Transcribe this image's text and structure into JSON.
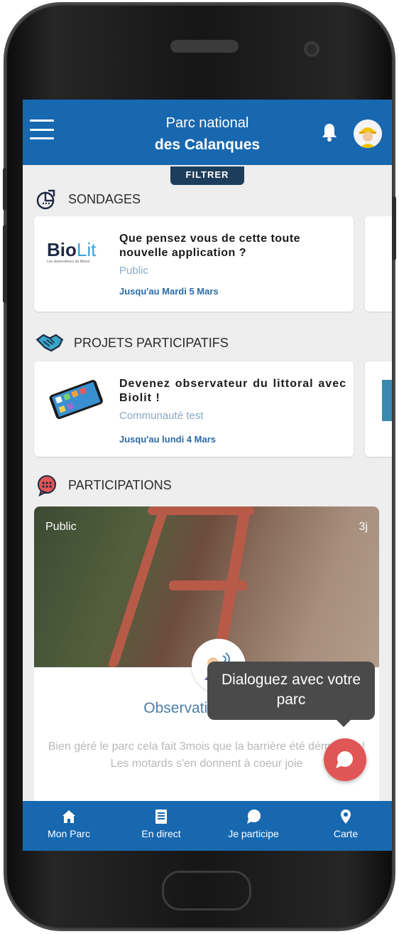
{
  "header": {
    "title_line1": "Parc national",
    "title_line2": "des Calanques",
    "filter_label": "FILTRER"
  },
  "sections": {
    "surveys": {
      "label": "SONDAGES",
      "card": {
        "logo_brand_dark": "Bio",
        "logo_brand_light": "Lit",
        "logo_tagline": "Les observateurs du littoral",
        "title": "Que pensez vous de cette toute nouvelle application ?",
        "audience": "Public",
        "deadline": "Jusqu'au Mardi 5 Mars"
      }
    },
    "projects": {
      "label": "PROJETS PARTICIPATIFS",
      "card": {
        "title": "Devenez observateur du littoral avec Biolit !",
        "audience": "Communauté test",
        "deadline": "Jusqu'au lundi 4 Mars"
      }
    },
    "participations": {
      "label": "PARTICIPATIONS",
      "card": {
        "visibility": "Public",
        "age": "3j",
        "title": "Observation de ED",
        "body": "Bien géré le parc cela fait 3mois que la barrière été démontée ! Les motards s'en donnent à coeur joie"
      }
    }
  },
  "tooltip": {
    "text": "Dialoguez avec votre parc"
  },
  "bottom_nav": {
    "items": [
      {
        "label": "Mon Parc",
        "icon": "home-icon"
      },
      {
        "label": "En direct",
        "icon": "document-icon"
      },
      {
        "label": "Je participe",
        "icon": "chat-icon"
      },
      {
        "label": "Carte",
        "icon": "map-pin-icon"
      }
    ]
  },
  "colors": {
    "primary": "#1868b0",
    "filter_bg": "#1d3d5c",
    "fab": "#e05555",
    "link": "#2c6aa5"
  }
}
